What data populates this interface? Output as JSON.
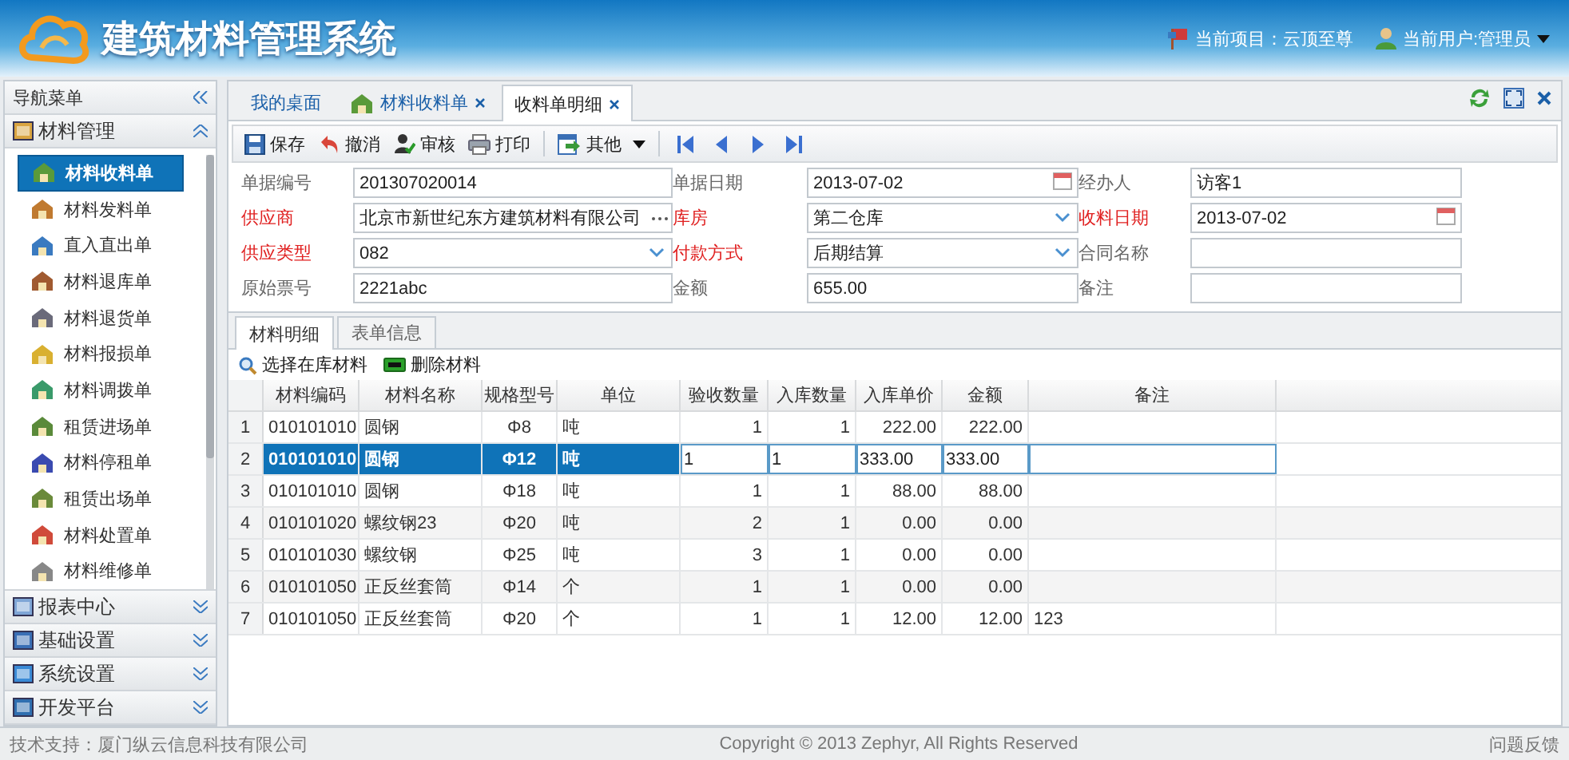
{
  "header": {
    "title": "建筑材料管理系统",
    "project": "当前项目：云顶至尊",
    "user": "当前用户:管理员"
  },
  "sidebar": {
    "title": "导航菜单",
    "sections": [
      {
        "label": "材料管理",
        "expanded": true,
        "items": [
          {
            "label": "材料收料单",
            "selected": true
          },
          {
            "label": "材料发料单",
            "selected": false
          },
          {
            "label": "直入直出单",
            "selected": false
          },
          {
            "label": "材料退库单",
            "selected": false
          },
          {
            "label": "材料退货单",
            "selected": false
          },
          {
            "label": "材料报损单",
            "selected": false
          },
          {
            "label": "材料调拨单",
            "selected": false
          },
          {
            "label": "租赁进场单",
            "selected": false
          },
          {
            "label": "材料停租单",
            "selected": false
          },
          {
            "label": "租赁出场单",
            "selected": false
          },
          {
            "label": "材料处置单",
            "selected": false
          },
          {
            "label": "材料维修单",
            "selected": false
          }
        ]
      },
      {
        "label": "报表中心",
        "expanded": false
      },
      {
        "label": "基础设置",
        "expanded": false
      },
      {
        "label": "系统设置",
        "expanded": false
      },
      {
        "label": "开发平台",
        "expanded": false
      }
    ]
  },
  "tabs": [
    {
      "label": "我的桌面",
      "selected": false,
      "closable": false
    },
    {
      "label": "材料收料单",
      "selected": false,
      "closable": true
    },
    {
      "label": "收料单明细",
      "selected": true,
      "closable": true
    }
  ],
  "toolbar": [
    {
      "label": "保存",
      "kind": "save"
    },
    {
      "label": "撤消",
      "kind": "undo"
    },
    {
      "label": "审核",
      "kind": "audit"
    },
    {
      "label": "打印",
      "kind": "print"
    },
    {
      "label": "其他",
      "kind": "more"
    }
  ],
  "form": [
    {
      "label": "单据编号",
      "required": false,
      "kind": "text",
      "value": "201307020014"
    },
    {
      "label": "单据日期",
      "required": false,
      "kind": "date",
      "value": "2013-07-02"
    },
    {
      "label": "经办人",
      "required": false,
      "kind": "text",
      "value": "访客1"
    },
    {
      "label": "供应商",
      "required": true,
      "kind": "lookup",
      "value": "北京市新世纪东方建筑材料有限公司"
    },
    {
      "label": "库房",
      "required": true,
      "kind": "select",
      "value": "第二仓库"
    },
    {
      "label": "收料日期",
      "required": true,
      "kind": "date",
      "value": "2013-07-02"
    },
    {
      "label": "供应类型",
      "required": true,
      "kind": "select",
      "value": "082"
    },
    {
      "label": "付款方式",
      "required": true,
      "kind": "select",
      "value": "后期结算"
    },
    {
      "label": "合同名称",
      "required": false,
      "kind": "text"
    },
    {
      "label": "原始票号",
      "required": false,
      "kind": "text",
      "value": "2221abc"
    },
    {
      "label": "金额",
      "required": false,
      "kind": "text",
      "value": "655.00"
    },
    {
      "label": "备注",
      "required": false,
      "kind": "text"
    }
  ],
  "subtabs": [
    {
      "label": "材料明细",
      "selected": true
    },
    {
      "label": "表单信息",
      "selected": false
    }
  ],
  "grid_actions": [
    {
      "label": "选择在库材料",
      "kind": "search"
    },
    {
      "label": "删除材料",
      "kind": "delete"
    }
  ],
  "table": {
    "columns": [
      "材料编码",
      "材料名称",
      "规格型号",
      "单位",
      "验收数量",
      "入库数量",
      "入库单价",
      "金额",
      "备注"
    ],
    "rows": [
      {
        "num": "1",
        "selected": false,
        "cells": [
          "010101010",
          "圆钢",
          "Φ8",
          "吨",
          "1",
          "1",
          "222.00",
          "222.00",
          ""
        ]
      },
      {
        "num": "2",
        "selected": true,
        "cells": [
          "010101010",
          "圆钢",
          "Φ12",
          "吨",
          "1",
          "1",
          "333.00",
          "333.00",
          ""
        ]
      },
      {
        "num": "3",
        "selected": false,
        "cells": [
          "010101010",
          "圆钢",
          "Φ18",
          "吨",
          "1",
          "1",
          "88.00",
          "88.00",
          ""
        ]
      },
      {
        "num": "4",
        "selected": false,
        "cells": [
          "010101020",
          "螺纹钢23",
          "Φ20",
          "吨",
          "2",
          "1",
          "0.00",
          "0.00",
          ""
        ]
      },
      {
        "num": "5",
        "selected": false,
        "cells": [
          "010101030",
          "螺纹钢",
          "Φ25",
          "吨",
          "3",
          "1",
          "0.00",
          "0.00",
          ""
        ]
      },
      {
        "num": "6",
        "selected": false,
        "cells": [
          "010101050",
          "正反丝套筒",
          "Φ14",
          "个",
          "1",
          "1",
          "0.00",
          "0.00",
          ""
        ]
      },
      {
        "num": "7",
        "selected": false,
        "cells": [
          "010101050",
          "正反丝套筒",
          "Φ20",
          "个",
          "1",
          "1",
          "12.00",
          "12.00",
          "123"
        ]
      }
    ]
  },
  "footer": {
    "support": "技术支持：厦门纵云信息科技有限公司",
    "copyright": "Copyright © 2013 Zephyr, All Rights Reserved",
    "feedback": "问题反馈"
  }
}
